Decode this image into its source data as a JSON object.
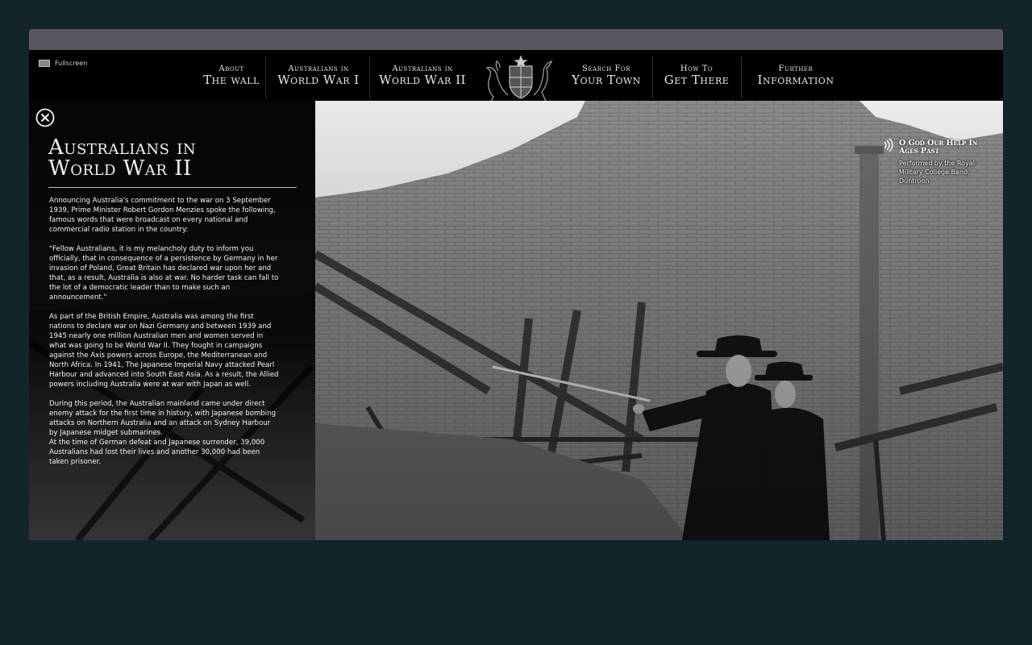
{
  "toolbar": {
    "fullscreen_label": "Fullscreen"
  },
  "nav": {
    "items": [
      {
        "line1": "About",
        "line2": "The wall"
      },
      {
        "line1": "Australians in",
        "line2": "World War I"
      },
      {
        "line1": "Australians in",
        "line2": "World War II"
      },
      {
        "line1": "Search For",
        "line2": "Your Town"
      },
      {
        "line1": "How To",
        "line2": "Get There"
      },
      {
        "line1": "Further",
        "line2": "Information"
      }
    ]
  },
  "panel": {
    "title_line1": "Australians in",
    "title_line2": "World War II",
    "paragraphs": [
      "Announcing Australia's commitment to the war on 3 September 1939, Prime Minister Robert Gordon Menzies spoke the following, famous words that were broadcast on every national and commercial radio station in the country:",
      "\"Fellow Australians, it is my melancholy duty to inform you officially, that in consequence of a persistence by Germany in her invasion of Poland, Great Britain has declared war upon her and that, as a result, Australia is also at war. No harder task can fall to the lot of a democratic leader than to make such an announcement.\"",
      "As part of the British Empire, Australia was among the first nations to declare war on Nazi Germany and between 1939 and 1945 nearly one million Australian men and women served in what was going to be World War II. They fought in campaigns against the Axis powers across Europe, the Mediterranean and North Africa. In 1941, The Japanese Imperial Navy attacked Pearl Harbour and advanced into South East Asia. As a result, the Allied powers including Australia were at war with Japan as well.",
      "During this period, the Australian mainland came under direct enemy attack for the first time in history, with Japanese bombing attacks on Northern Australia and an attack on Sydney Harbour by Japanese midget submarines.",
      "At the time of German defeat and Japanese surrender, 39,000 Australians had lost their lives and another 30,000 had been taken prisoner."
    ]
  },
  "audio": {
    "title": "O God Our Help In Ages Past",
    "subtitle": "Performed by the Royal Military College Band, Duntroon"
  },
  "colors": {
    "page_background": "#14252a",
    "topbar": "#58575f",
    "nav_background": "#000000",
    "text": "#f2f2f2"
  }
}
